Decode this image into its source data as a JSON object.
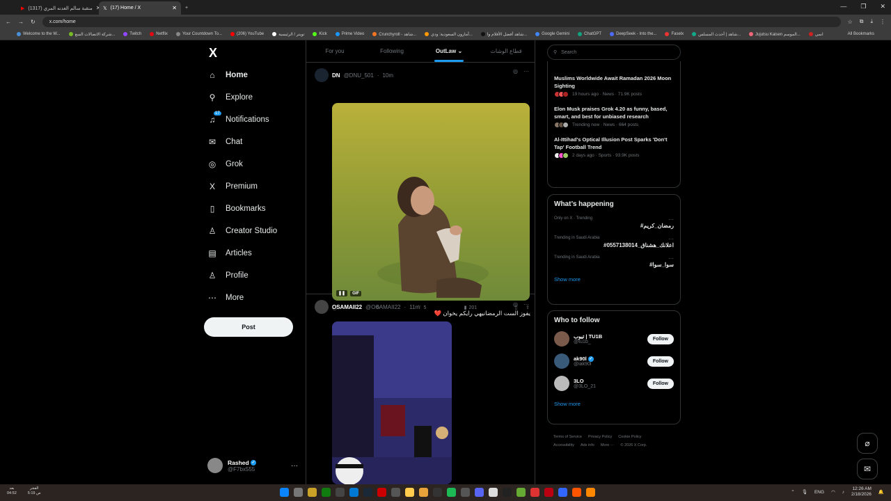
{
  "browser": {
    "tabs": [
      {
        "label": "(1317) منقبة سالم العدنه المري",
        "active": false
      },
      {
        "label": "(17) Home / X",
        "active": true
      }
    ],
    "new_tab": "+",
    "url": "x.com/home",
    "bookmarks": [
      "Welcome to the W...",
      "شركة الاتصالات السع...",
      "Twitch",
      "Netflix",
      "Your Countdown To...",
      "(206) YouTube",
      "تويتر / الرئيسية",
      "Kick",
      "Prime Video",
      "Crunchyroll - شاهد...",
      "أمازون السعودية: ودي...",
      "شاهد أفضل الأفلام وا...",
      "Google Gemini",
      "ChatGPT",
      "DeepSeek - Into the...",
      "Faselx",
      "شاهد | أحدث المسلس...",
      "Jujutsu Kaisen الموسم...",
      "انمي"
    ],
    "all_bookmarks": "All Bookmarks"
  },
  "sidebar": {
    "logo": "X",
    "notifications_badge": "17",
    "items": [
      {
        "label": "Home",
        "icon": "home-icon",
        "glyph": "⌂"
      },
      {
        "label": "Explore",
        "icon": "search-icon",
        "glyph": "⚲"
      },
      {
        "label": "Notifications",
        "icon": "bell-icon",
        "glyph": "♫"
      },
      {
        "label": "Chat",
        "icon": "mail-icon",
        "glyph": "✉"
      },
      {
        "label": "Grok",
        "icon": "grok-icon",
        "glyph": "◎"
      },
      {
        "label": "Premium",
        "icon": "x-premium-icon",
        "glyph": "X"
      },
      {
        "label": "Bookmarks",
        "icon": "bookmark-icon",
        "glyph": "▯"
      },
      {
        "label": "Creator Studio",
        "icon": "creator-studio-icon",
        "glyph": "♙"
      },
      {
        "label": "Articles",
        "icon": "articles-icon",
        "glyph": "▤"
      },
      {
        "label": "Profile",
        "icon": "profile-icon",
        "glyph": "♙"
      },
      {
        "label": "More",
        "icon": "more-circle-icon",
        "glyph": "⋯"
      }
    ],
    "post_label": "Post",
    "account": {
      "name": "Rashed",
      "handle": "@F7bx555",
      "more": "···"
    }
  },
  "feed": {
    "tabs": [
      "For you",
      "Following",
      "OutLaw",
      "قطاع الوشاث"
    ],
    "tweets": [
      {
        "name": "DN",
        "handle": "@DNU_501",
        "time": "10m",
        "gif_label": "GIF",
        "replies": "",
        "reposts": "",
        "likes": "5",
        "views": "201"
      },
      {
        "name": "OSAMAII22",
        "handle": "@OSAMAII22",
        "time": "11m",
        "text": "يفوز الست الرمضانيهي رايكم يخوان ❤️"
      }
    ],
    "sep": "·"
  },
  "right": {
    "search_placeholder": "Search",
    "news": [
      {
        "title": "Muslims Worldwide Await Ramadan 2026 Moon Sighting",
        "meta": "19 hours ago · News · 71.9K posts"
      },
      {
        "title": "Elon Musk praises Grok 4.20 as funny, based, smart, and best for unbiased research",
        "meta": "Trending now · News · 664 posts"
      },
      {
        "title": "Al-Ittihad's Optical Illusion Post Sparks 'Don't Tap' Football Trend",
        "meta": "2 days ago · Sports · 93.9K posts"
      }
    ],
    "whats_happening": "What’s happening",
    "trends": [
      {
        "category": "Only on X · Trending",
        "name": "#رمضان_كريم"
      },
      {
        "category": "Trending in Saudi Arabia",
        "name": "#اعلانك_هشناق_0557138014"
      },
      {
        "category": "Trending in Saudi Arabia",
        "name": "#سوا_سوا"
      }
    ],
    "show_more": "Show more",
    "who_to_follow": "Who to follow",
    "follow_label": "Follow",
    "suggestions": [
      {
        "name": "تيوب | TU1B",
        "handle": "@tu1b_",
        "verified": false
      },
      {
        "name": "ak90l",
        "handle": "@iak90l",
        "verified": true
      },
      {
        "name": "3LO",
        "handle": "@3LO_21",
        "verified": false
      }
    ],
    "footer": [
      "Terms of Service",
      "Privacy Policy",
      "Cookie Policy",
      "Accessibility",
      "Ads info",
      "More ···",
      "© 2026 X Corp."
    ]
  },
  "taskbar": {
    "left1": "بعد\n04:52",
    "left2": "الفجر\n5:19 ص",
    "lang": "ENG",
    "time": "12:26 AM",
    "date": "2/18/2026"
  },
  "colors": {
    "accent": "#1d9bf0",
    "background": "#000000",
    "border": "#2f3336",
    "muted": "#71767b"
  }
}
